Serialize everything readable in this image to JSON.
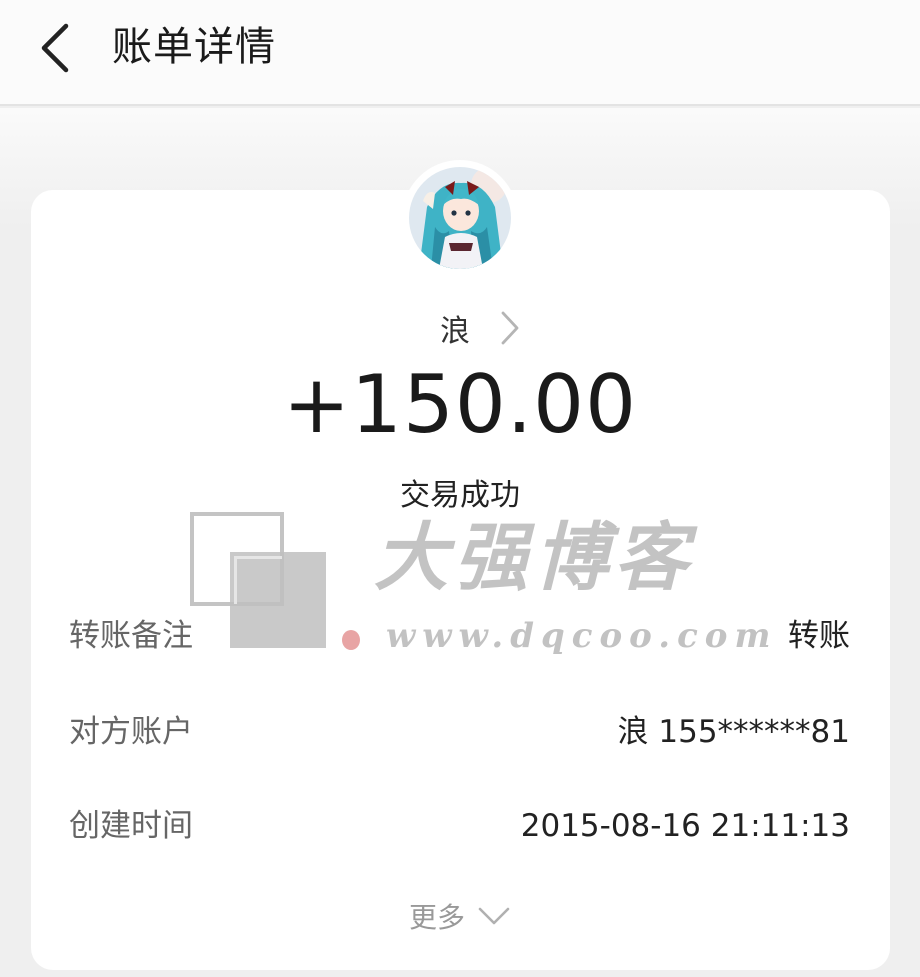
{
  "header": {
    "back_icon": "chevron-left-icon",
    "title": "账单详情"
  },
  "counterparty": {
    "avatar_icon": "anime-avatar",
    "name": "浪",
    "chevron_icon": "chevron-right-icon"
  },
  "transaction": {
    "amount": "+150.00",
    "status": "交易成功"
  },
  "details": [
    {
      "label": "转账备注",
      "value": "转账"
    },
    {
      "label": "对方账户",
      "value": "浪 155******81"
    },
    {
      "label": "创建时间",
      "value": "2015-08-16 21:11:13"
    }
  ],
  "more": {
    "label": "更多",
    "chevron_icon": "chevron-down-icon"
  },
  "watermark": {
    "title": "大强博客",
    "url": "www.dqcoo.com"
  },
  "colors": {
    "page_bg": "#efefef",
    "card_bg": "#ffffff",
    "label_gray": "#666666",
    "value_dark": "#222222",
    "more_gray": "#999999"
  }
}
